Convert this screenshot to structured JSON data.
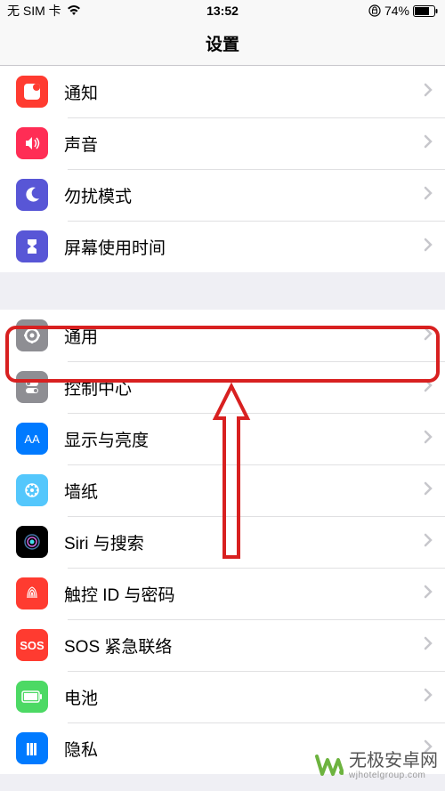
{
  "status": {
    "carrier": "无 SIM 卡",
    "time": "13:52",
    "battery": "74%"
  },
  "nav": {
    "title": "设置"
  },
  "group1": [
    {
      "label": "通知",
      "iconName": "notifications-icon",
      "iconBg": "#ff3b30"
    },
    {
      "label": "声音",
      "iconName": "sounds-icon",
      "iconBg": "#ff2d55"
    },
    {
      "label": "勿扰模式",
      "iconName": "dnd-icon",
      "iconBg": "#5856d6"
    },
    {
      "label": "屏幕使用时间",
      "iconName": "screentime-icon",
      "iconBg": "#5856d6"
    }
  ],
  "group2": [
    {
      "label": "通用",
      "iconName": "general-icon",
      "iconBg": "#8e8e93"
    },
    {
      "label": "控制中心",
      "iconName": "control-center-icon",
      "iconBg": "#8e8e93"
    },
    {
      "label": "显示与亮度",
      "iconName": "display-icon",
      "iconBg": "#007aff"
    },
    {
      "label": "墙纸",
      "iconName": "wallpaper-icon",
      "iconBg": "#54c7fc"
    },
    {
      "label": "Siri 与搜索",
      "iconName": "siri-icon",
      "iconBg": "#000"
    },
    {
      "label": "触控 ID 与密码",
      "iconName": "touchid-icon",
      "iconBg": "#ff3b30"
    },
    {
      "label": "SOS 紧急联络",
      "iconName": "sos-icon",
      "iconBg": "#ff3b30",
      "textIcon": "SOS"
    },
    {
      "label": "电池",
      "iconName": "battery-icon",
      "iconBg": "#4cd964"
    },
    {
      "label": "隐私",
      "iconName": "privacy-icon",
      "iconBg": "#007aff"
    }
  ],
  "highlightedItem": "通用",
  "watermark": {
    "main": "无极安卓网",
    "sub": "wjhotelgroup.com"
  }
}
